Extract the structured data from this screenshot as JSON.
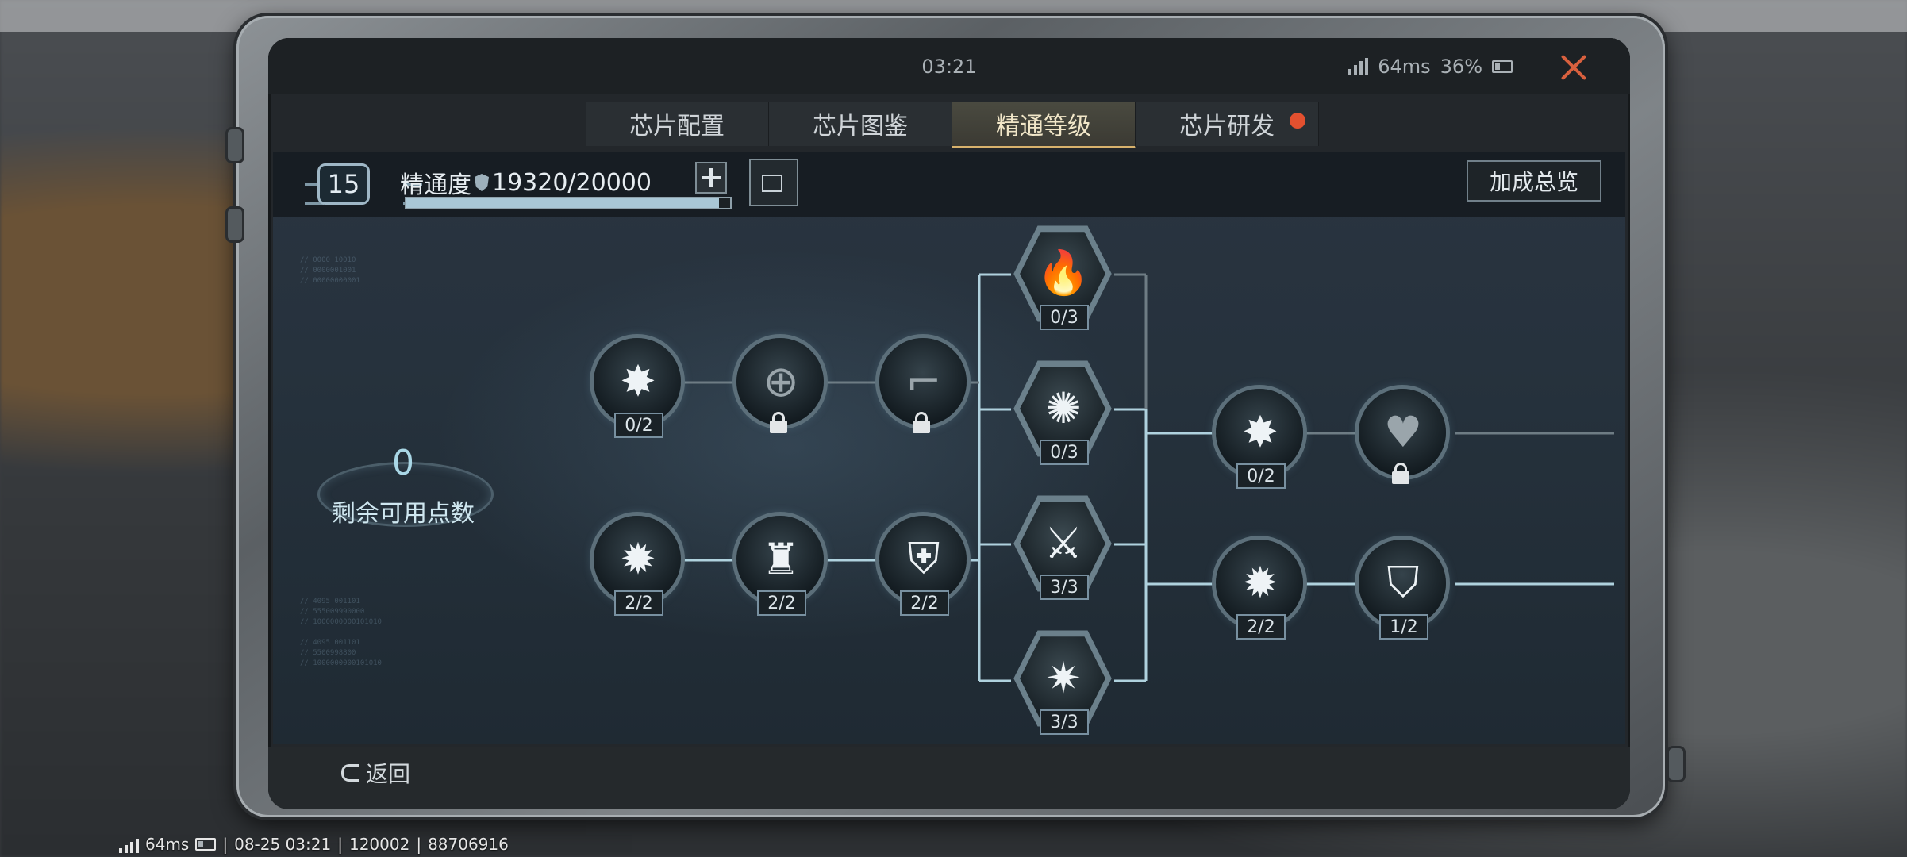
{
  "status_bar": {
    "time": "03:21",
    "ping": "64ms",
    "battery": "36%"
  },
  "tabs": [
    {
      "label": "芯片配置",
      "active": false
    },
    {
      "label": "芯片图鉴",
      "active": false
    },
    {
      "label": "精通等级",
      "active": true
    },
    {
      "label": "芯片研发",
      "active": false,
      "notification": true
    }
  ],
  "header": {
    "level": "15",
    "mastery_label": "精通度",
    "mastery_value": "19320/20000",
    "mastery_progress": 0.966,
    "summary_button": "加成总览"
  },
  "points": {
    "value": "0",
    "label": "剩余可用点数"
  },
  "nodes": {
    "n_top_1": {
      "count": "0/2",
      "icon": "damage-boost-icon"
    },
    "n_top_2": {
      "icon": "crosshair-icon",
      "locked": true
    },
    "n_top_3": {
      "icon": "pistol-icon",
      "locked": true
    },
    "n_bot_1": {
      "count": "2/2",
      "icon": "shield-boost-icon"
    },
    "n_bot_2": {
      "count": "2/2",
      "icon": "dodge-icon"
    },
    "n_bot_3": {
      "count": "2/2",
      "icon": "armor-vest-icon"
    },
    "hex_1": {
      "count": "0/3",
      "icon": "fire-magazine-icon"
    },
    "hex_2": {
      "count": "0/3",
      "icon": "grenade-icon"
    },
    "hex_3": {
      "count": "3/3",
      "icon": "blade-icon"
    },
    "hex_4": {
      "count": "3/3",
      "icon": "impact-shield-icon"
    },
    "n_r_top_1": {
      "count": "0/2",
      "icon": "damage-boost-icon"
    },
    "n_r_top_2": {
      "icon": "heart-boost-icon",
      "locked": true
    },
    "n_r_bot_1": {
      "count": "2/2",
      "icon": "shield-boost-icon"
    },
    "n_r_bot_2": {
      "count": "1/2",
      "icon": "armor-boost-icon"
    }
  },
  "bottom": {
    "back_label": "返回"
  },
  "system_bar": {
    "ping": "64ms",
    "datetime": "08-25 03:21",
    "code1": "120002",
    "code2": "88706916"
  },
  "colors": {
    "accent_active_tab": "#d8b26c",
    "notification": "#e3502f",
    "close": "#d8603e",
    "tree_line": "#bfe3f0"
  }
}
